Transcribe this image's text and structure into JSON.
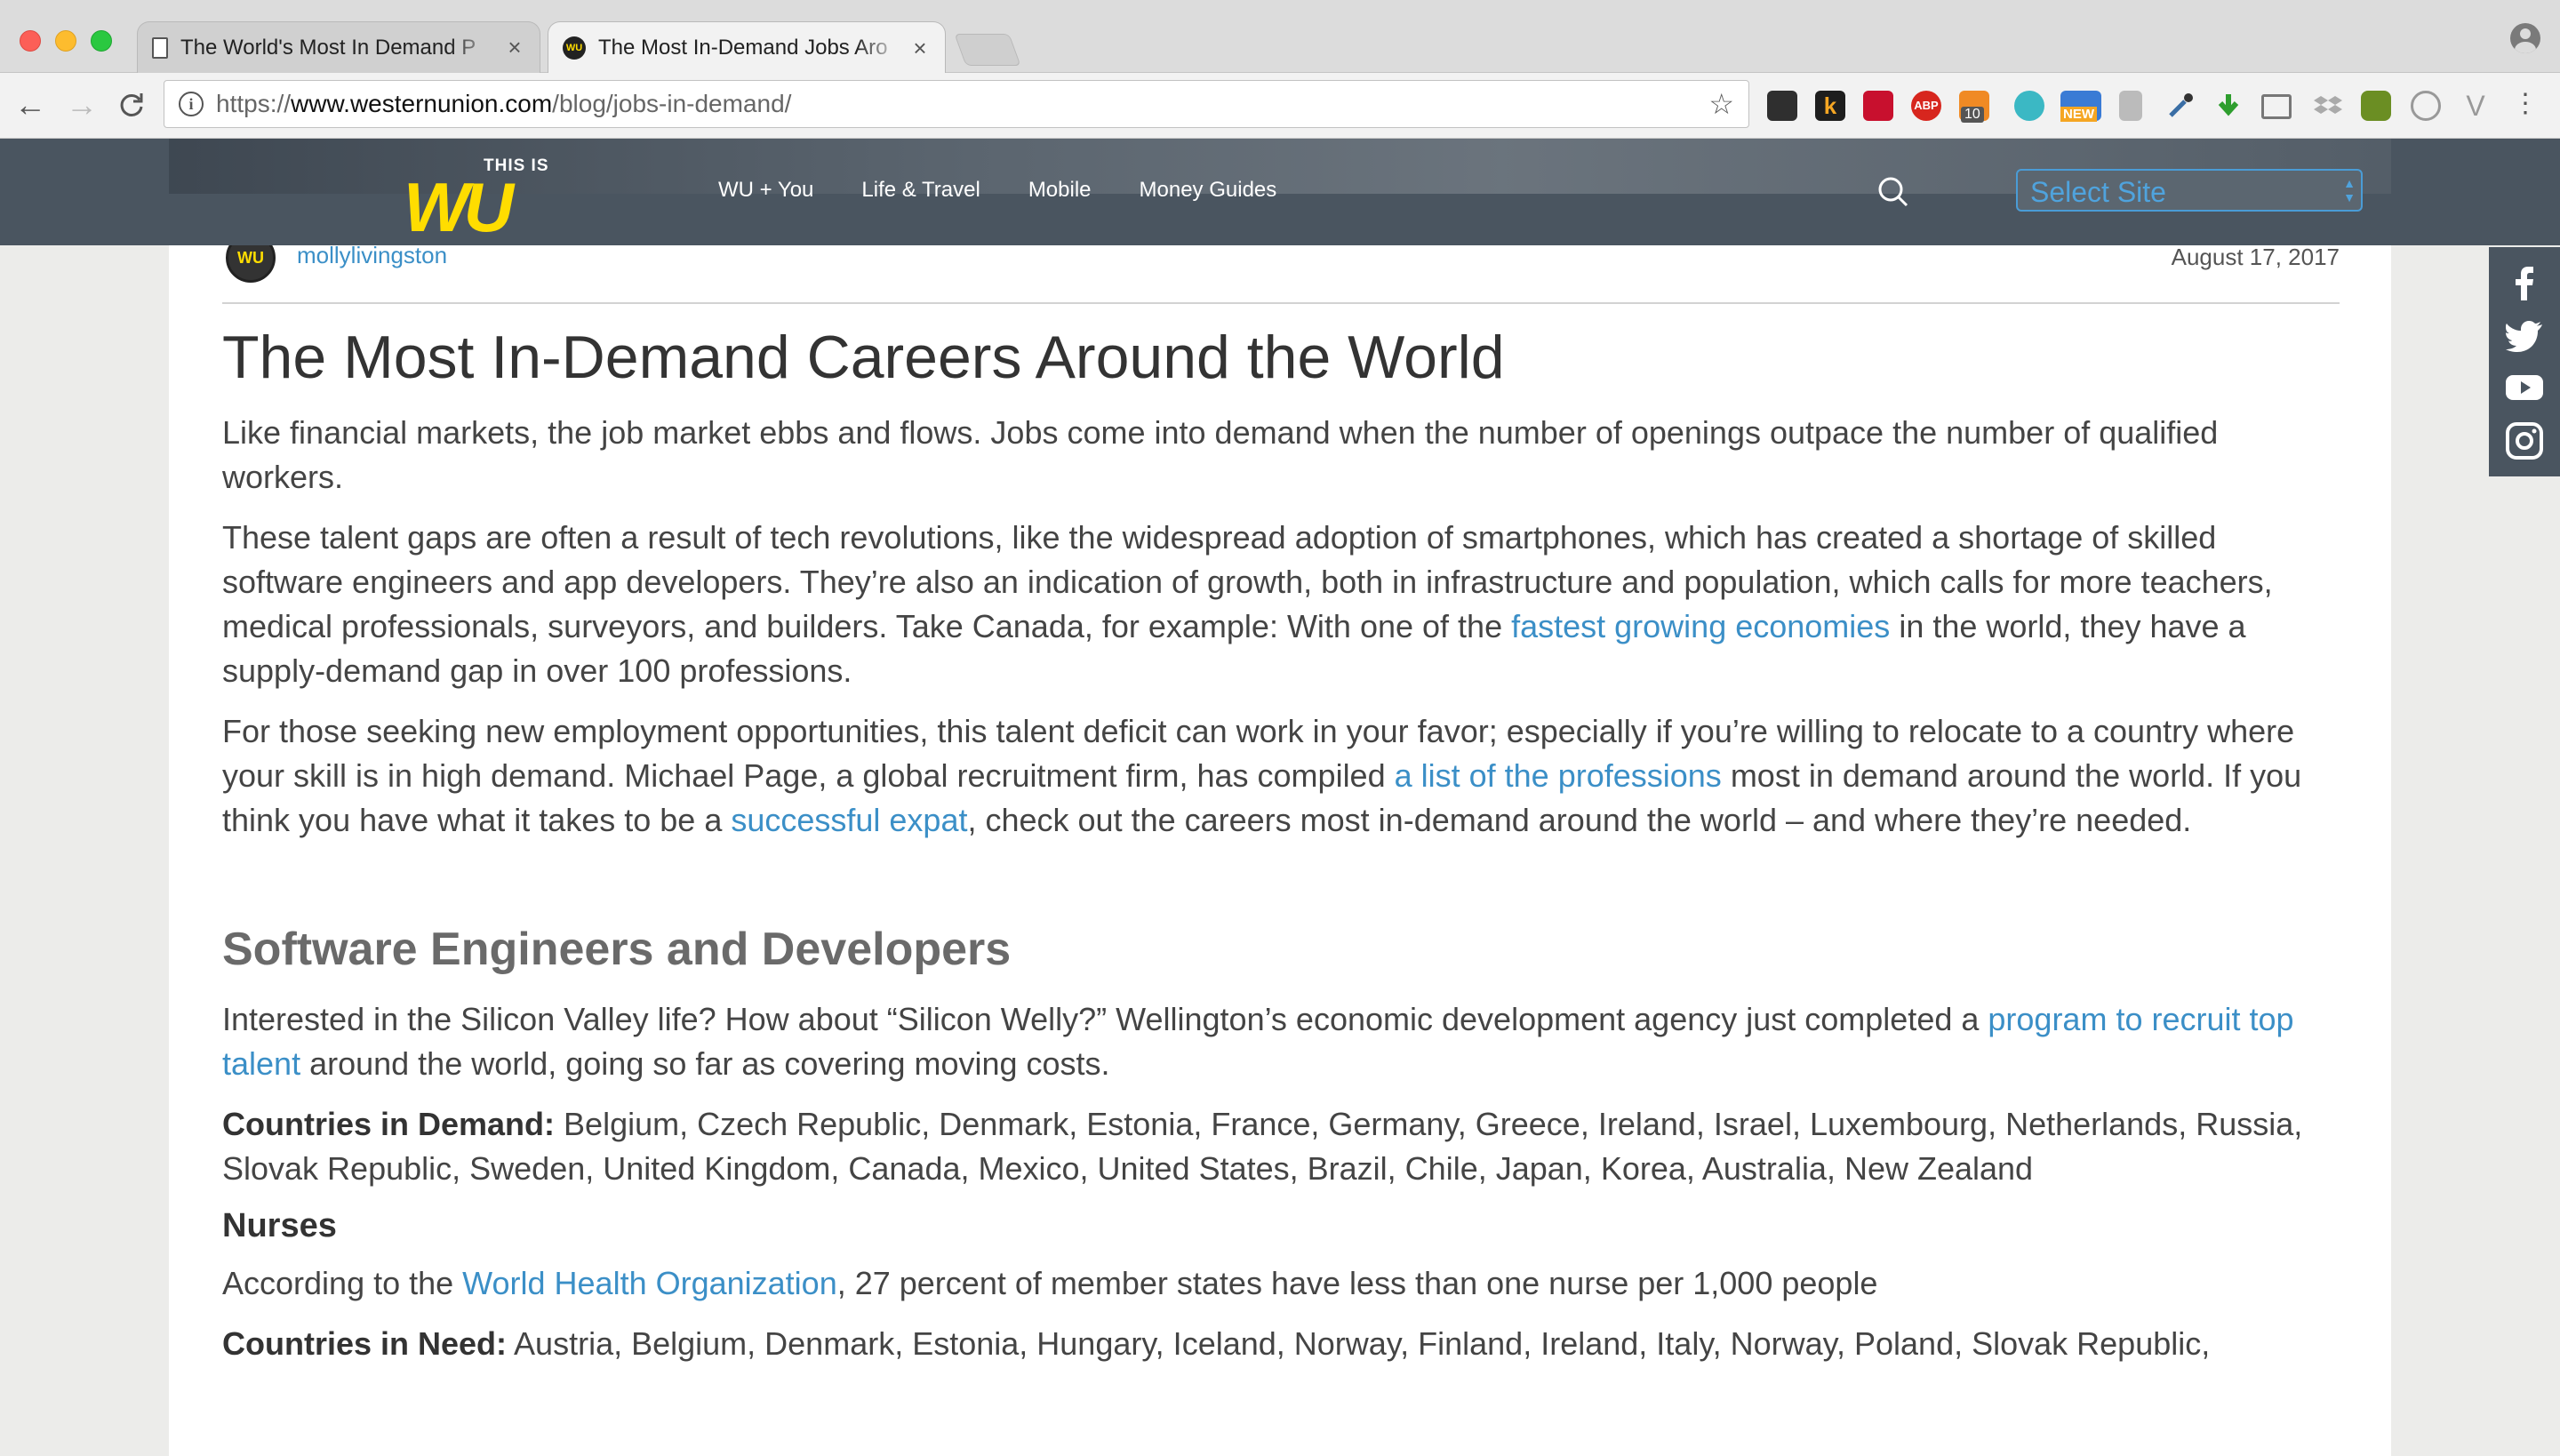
{
  "browser": {
    "tabs": [
      {
        "title": "The World's Most In Demand P",
        "active": false
      },
      {
        "title": "The Most In-Demand Jobs Aro",
        "active": true
      }
    ],
    "url_scheme": "https://",
    "url_host": "www.westernunion.com",
    "url_path": "/blog/jobs-in-demand/",
    "extensions": [
      "evernote-icon",
      "k-icon",
      "lastpass-icon",
      "adblock-icon",
      "badge-10-icon",
      "m-icon",
      "new-icon",
      "bookmark-icon",
      "eyedropper-icon",
      "download-icon",
      "cast-icon",
      "dropbox-icon",
      "sun-icon",
      "gear-icon",
      "vee-icon",
      "more-icon"
    ],
    "ext_badge": "10",
    "ext_new": "NEW"
  },
  "site": {
    "logo_small": "THIS IS",
    "logo_mark": "WU",
    "menu": [
      "WU + You",
      "Life & Travel",
      "Mobile",
      "Money Guides"
    ],
    "select_placeholder": "Select Site",
    "accent": "#ffdd00",
    "link_color": "#3b8fc7"
  },
  "post": {
    "avatar_text": "WU",
    "author": "mollylivingston",
    "date": "August 17, 2017",
    "title": "The Most In-Demand Careers Around the World",
    "p1": "Like financial markets, the job market ebbs and flows. Jobs come into demand when the number of openings outpace the number of qualified workers.",
    "p2_a": "These talent gaps are often a result of tech revolutions, like the widespread adoption of smartphones, which has created a shortage of skilled software engineers and app developers. They’re also an indication of growth, both in infrastructure and population, which calls for more teachers, medical professionals, surveyors, and builders. Take Canada, for example: With one of the ",
    "p2_link": "fastest growing economies",
    "p2_b": " in the world, they have a supply-demand gap in over 100 professions.",
    "p3_a": "For those seeking new employment opportunities, this talent deficit can work in your favor; especially if you’re willing to relocate to a country where your skill is in high demand. Michael Page, a global recruitment firm, has compiled ",
    "p3_link1": "a list of the professions",
    "p3_b": " most in demand around the world. If you think you have what it takes to be a ",
    "p3_link2": "successful expat",
    "p3_c": ", check out the careers most in-demand around the world – and where they’re needed.",
    "h2": "Software Engineers and Developers",
    "p4_a": "Interested in the Silicon Valley life? How about “Silicon Welly?” Wellington’s economic development agency just completed a ",
    "p4_link": "program to recruit top talent",
    "p4_b": " around the world, going so far as covering moving costs.",
    "countries1_label": "Countries in Demand:",
    "countries1": " Belgium, Czech Republic, Denmark, Estonia, France, Germany, Greece, Ireland, Israel, Luxembourg, Netherlands, Russia, Slovak Republic, Sweden, United Kingdom, Canada, Mexico, United States, Brazil, Chile, Japan, Korea, Australia, New Zealand",
    "h3": "Nurses",
    "p5_a": "According to the ",
    "p5_link": "World Health Organization",
    "p5_b": ", 27 percent of member states have less than one nurse per 1,000 people",
    "countries2_label": "Countries in Need:",
    "countries2": " Austria, Belgium, Denmark, Estonia, Hungary, Iceland, Norway, Finland, Ireland, Italy, Norway, Poland, Slovak Republic,"
  },
  "social": [
    "facebook-icon",
    "twitter-icon",
    "youtube-icon",
    "instagram-icon"
  ]
}
